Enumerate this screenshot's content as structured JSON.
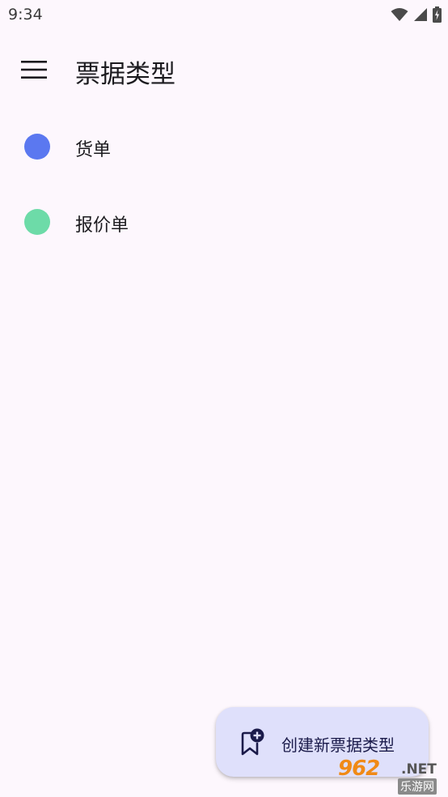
{
  "status_bar": {
    "time": "9:34",
    "icons": [
      "wifi-icon",
      "signal-icon",
      "battery-charging-icon"
    ]
  },
  "app_bar": {
    "menu_icon": "menu-icon",
    "title": "票据类型"
  },
  "document_types": [
    {
      "label": "货单",
      "color": "#5b78f0"
    },
    {
      "label": "报价单",
      "color": "#6ddba8"
    }
  ],
  "fab": {
    "icon": "bookmark-add-icon",
    "label": "创建新票据类型"
  },
  "watermark": {
    "brand": "962",
    "suffix": ".NET",
    "subtitle": "乐游网"
  },
  "colors": {
    "background": "#fdf7fd",
    "fab_background": "#dfe0fb",
    "fab_text": "#1b1b4a"
  }
}
